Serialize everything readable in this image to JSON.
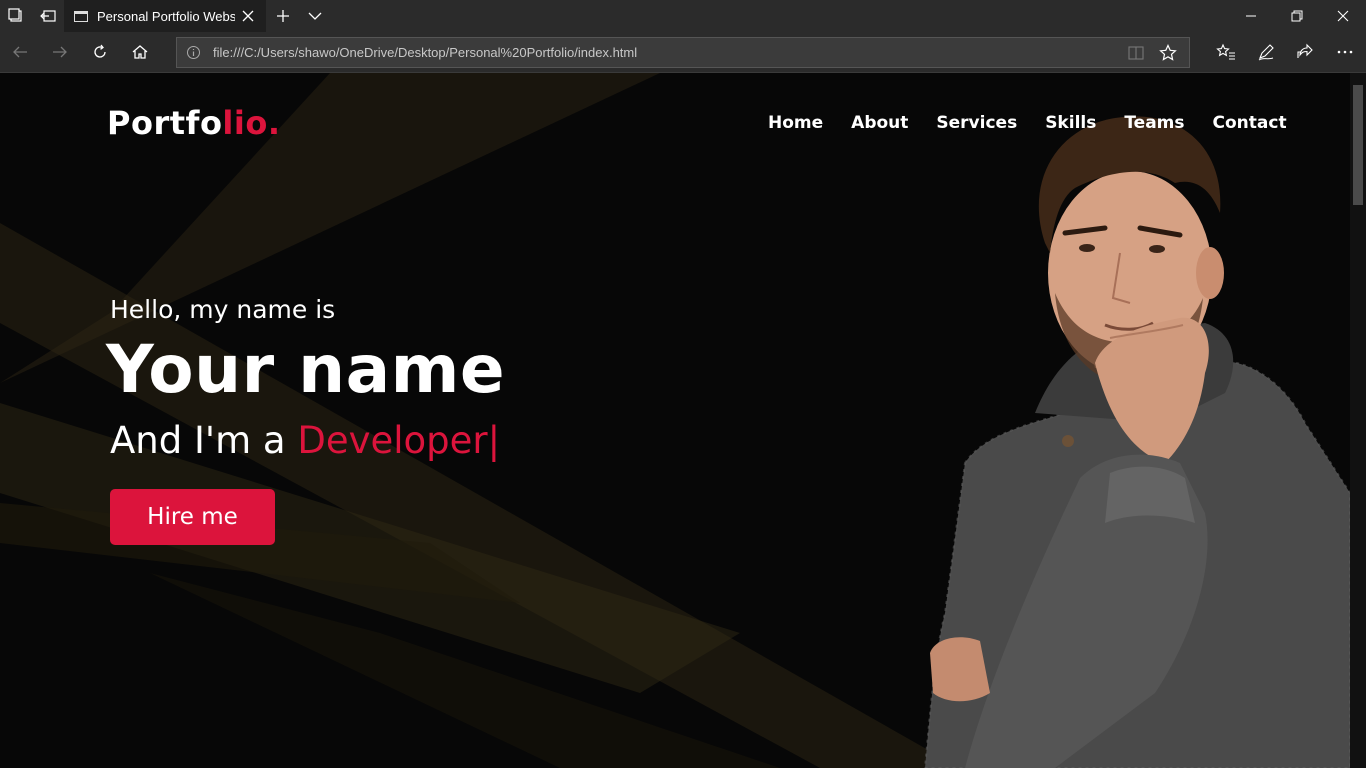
{
  "browser": {
    "tab_title": "Personal Portfolio Webs",
    "url": "file:///C:/Users/shawo/OneDrive/Desktop/Personal%20Portfolio/index.html"
  },
  "page": {
    "logo": {
      "main": "Portfo",
      "accent": "lio."
    },
    "nav": [
      "Home",
      "About",
      "Services",
      "Skills",
      "Teams",
      "Contact"
    ],
    "hero": {
      "greeting": "Hello, my name is",
      "name": "Your name",
      "role_prefix": "And I'm a ",
      "role_typed": "Developer",
      "cursor": "|",
      "cta": "Hire me"
    }
  },
  "colors": {
    "accent": "#dc143c",
    "background": "#070707",
    "chrome": "#2b2b2b"
  },
  "icons": {
    "tabbar": [
      "tabs-icon",
      "back-tabs-icon",
      "new-tab-icon",
      "tab-list-icon"
    ],
    "addressbar": [
      "back-icon",
      "forward-icon",
      "refresh-icon",
      "home-icon",
      "info-icon",
      "reading-view-icon",
      "favorite-star-icon",
      "favorites-hub-icon",
      "pen-icon",
      "share-icon",
      "more-icon"
    ]
  }
}
